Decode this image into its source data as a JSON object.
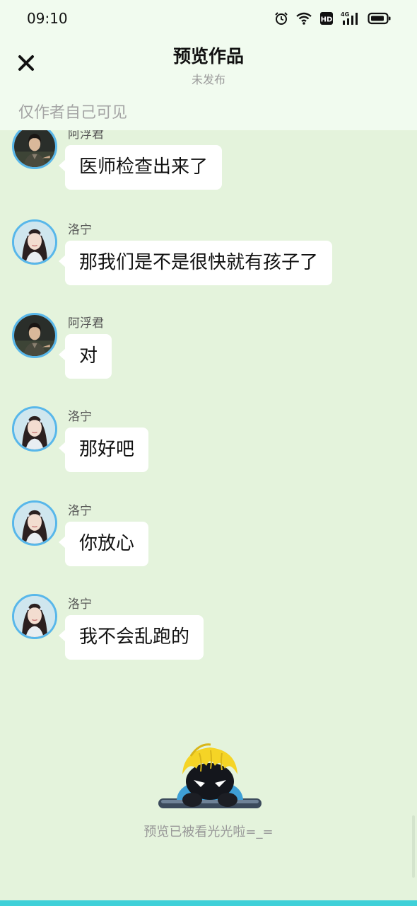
{
  "status_bar": {
    "time": "09:10",
    "icons": [
      "alarm-icon",
      "wifi-icon",
      "hd-icon",
      "4g-signal-icon",
      "battery-icon"
    ],
    "network_label": "4G",
    "hd_label": "HD"
  },
  "header": {
    "close_icon": "close-icon",
    "title": "预览作品",
    "subtitle": "未发布",
    "visibility_note": "仅作者自己可见"
  },
  "messages": [
    {
      "sender": "阿浮君",
      "text": "医师检查出来了",
      "avatar": "male"
    },
    {
      "sender": "洛宁",
      "text": "那我们是不是很快就有孩子了",
      "avatar": "female"
    },
    {
      "sender": "阿浮君",
      "text": "对",
      "avatar": "male"
    },
    {
      "sender": "洛宁",
      "text": "那好吧",
      "avatar": "female"
    },
    {
      "sender": "洛宁",
      "text": "你放心",
      "avatar": "female"
    },
    {
      "sender": "洛宁",
      "text": "我不会乱跑的",
      "avatar": "female"
    }
  ],
  "end_of_preview": {
    "mascot": "peeking-mascot-icon",
    "text": "预览已被看光光啦=_="
  },
  "colors": {
    "page_background": "#e4f3dc",
    "header_background": "#f1fbef",
    "avatar_ring": "#58b7ea",
    "bubble": "#ffffff",
    "bottom_accent": "#3fd0d8"
  }
}
